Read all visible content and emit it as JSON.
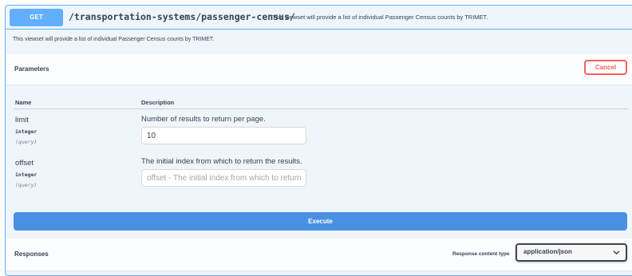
{
  "operation": {
    "method": "GET",
    "path": "/transportation-systems/passenger-census/",
    "summary": "This viewset will provide a list of individual Passenger Census counts by TRIMET.",
    "description": "This viewset will provide a list of individual Passenger Census counts by TRIMET."
  },
  "parameters": {
    "title": "Parameters",
    "cancel_label": "Cancel",
    "col_name": "Name",
    "col_description": "Description",
    "items": [
      {
        "name": "limit",
        "type": "integer",
        "in": "(query)",
        "description": "Number of results to return per page.",
        "value": "10",
        "placeholder": ""
      },
      {
        "name": "offset",
        "type": "integer",
        "in": "(query)",
        "description": "The initial index from which to return the results.",
        "value": "",
        "placeholder": "offset - The initial index from which to return the results."
      }
    ]
  },
  "execute_label": "Execute",
  "responses": {
    "title": "Responses",
    "content_type_label": "Response content type",
    "content_type_value": "application/json"
  },
  "colors": {
    "get_accent": "#61affe",
    "get_background": "#eef5fb",
    "execute": "#4990e2",
    "cancel": "#ff6060"
  }
}
